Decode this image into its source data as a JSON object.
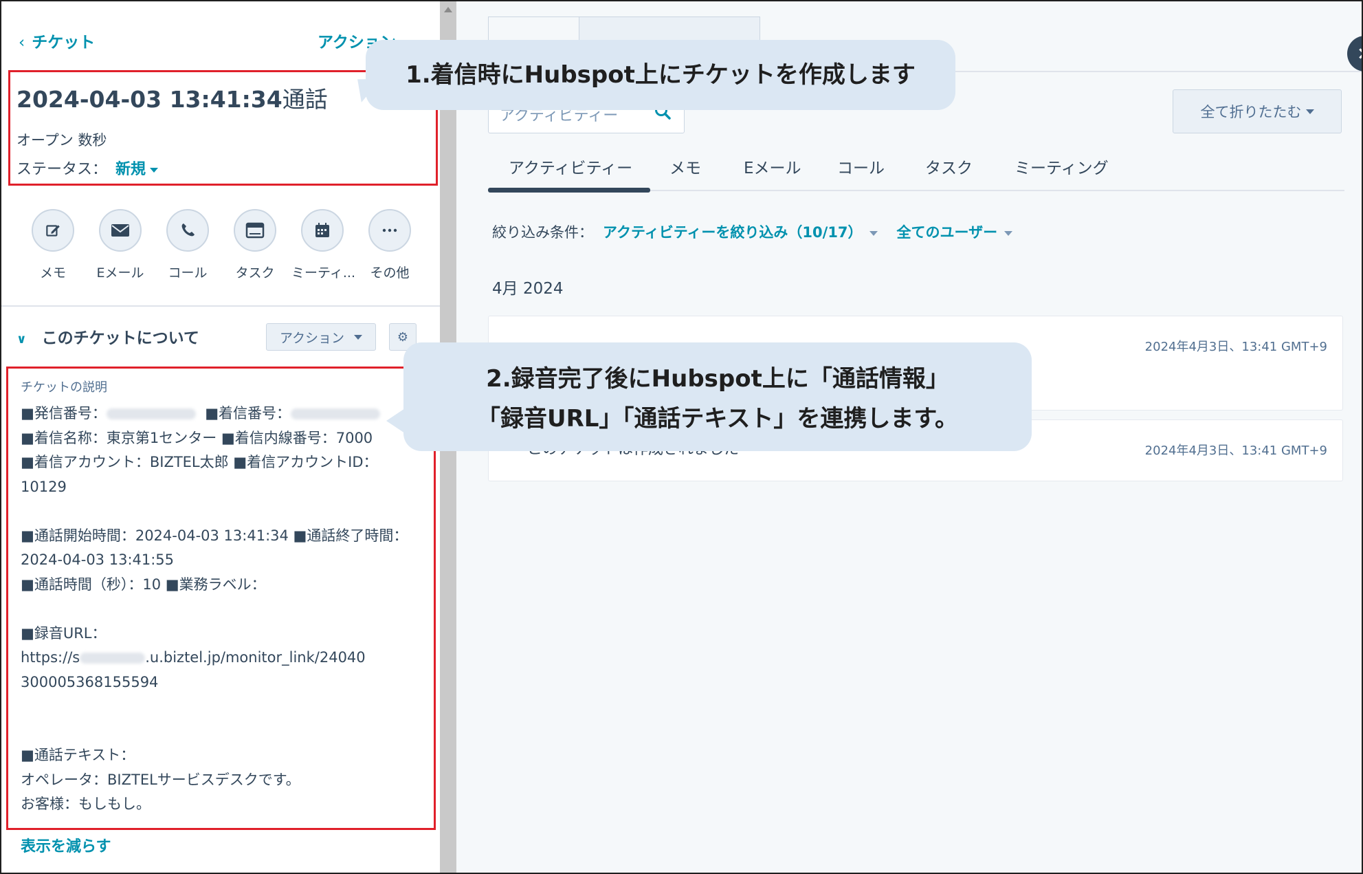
{
  "left_panel": {
    "back_link": "チケット",
    "top_action": "アクション",
    "ticket": {
      "title_datetime": "2024-04-03 13:41:34",
      "title_suffix": "通話",
      "open_text": "オープン 数秒",
      "status_label": "ステータス：",
      "status_value": "新規"
    },
    "quick_actions": [
      {
        "label": "メモ",
        "icon": "edit-icon"
      },
      {
        "label": "Eメール",
        "icon": "email-icon"
      },
      {
        "label": "コール",
        "icon": "phone-icon"
      },
      {
        "label": "タスク",
        "icon": "task-icon"
      },
      {
        "label": "ミーティ...",
        "icon": "calendar-icon"
      },
      {
        "label": "その他",
        "icon": "more-icon"
      }
    ],
    "about": {
      "title": "このチケットについて",
      "action_label": "アクション"
    },
    "description": {
      "label": "チケットの説明",
      "caller_label": "■発信番号：",
      "callee_label": "■着信番号：",
      "line3": "■着信名称：東京第1センター ■着信内線番号：7000",
      "line4": "■着信アカウント：BIZTEL太郎 ■着信アカウントID：",
      "line5": "10129",
      "line7": "■通話開始時間：2024-04-03 13:41:34 ■通話終了時間：",
      "line8": "2024-04-03 13:41:55",
      "line9": "■通話時間（秒）：10 ■業務ラベル：",
      "line11": "■録音URL：",
      "url_prefix": "https://s",
      "url_suffix": ".u.biztel.jp/monitor_link/24040",
      "line13": "300005368155594",
      "line16": "■通話テキスト：",
      "line17": "オペレータ：BIZTELサービスデスクです。",
      "line18": "お客様：もしもし。"
    },
    "show_less": "表示を減らす"
  },
  "right_panel": {
    "search_placeholder": "アクティビティー",
    "collapse_all": "全て折りたたむ",
    "activity_tabs": [
      "アクティビティー",
      "メモ",
      "Eメール",
      "コール",
      "タスク",
      "ミーティング"
    ],
    "filter_label": "絞り込み条件：",
    "filter_activity": "アクティビティーを絞り込み（10/17）",
    "filter_users": "全てのユーザー",
    "month": "4月 2024",
    "cards": [
      {
        "time": "2024年4月3日、13:41 GMT+9"
      },
      {
        "title": "このチケットは作成されました",
        "time": "2024年4月3日、13:41 GMT+9"
      }
    ]
  },
  "callouts": {
    "c1": "1.着信時にHubspot上にチケットを作成します",
    "c2_line1": "2.録音完了後にHubspot上に「通話情報」",
    "c2_line2": "「録音URL」「通話テキスト」を連携します。"
  },
  "colors": {
    "accent": "#0091ae",
    "text": "#33475b",
    "highlight_box": "#e0202a",
    "callout_bg": "#dbe7f3"
  }
}
